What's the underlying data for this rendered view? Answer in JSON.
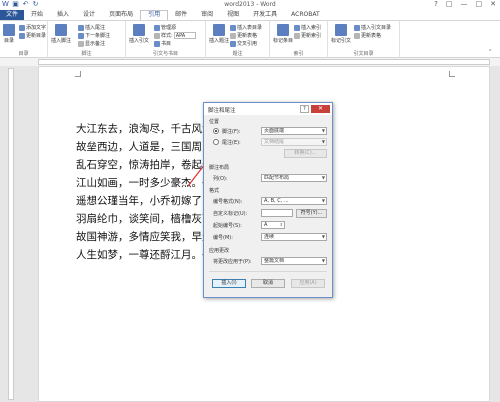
{
  "window": {
    "title": "word2013 - Word",
    "controls": [
      "?",
      "□",
      "—",
      "□",
      "✕"
    ]
  },
  "tabs": [
    "文件",
    "开始",
    "插入",
    "设计",
    "页面布局",
    "引用",
    "邮件",
    "审阅",
    "视图",
    "开发工具",
    "ACROBAT"
  ],
  "ribbon": {
    "toc": {
      "big": "目录",
      "items": [
        "添加文字",
        "更新目录"
      ],
      "label": "目录"
    },
    "footnotes": {
      "big": "插入脚注",
      "items": [
        "插入尾注",
        "下一条脚注",
        "显示备注"
      ],
      "label": "脚注"
    },
    "citations": {
      "big": "插入引文",
      "items": [
        "管理源",
        "样式:",
        "书目"
      ],
      "style_value": "APA",
      "label": "引文与书目"
    },
    "captions": {
      "big": "插入题注",
      "items": [
        "插入表目录",
        "更新表格",
        "交叉引用"
      ],
      "label": "题注"
    },
    "index": {
      "big": "标记条目",
      "items": [
        "插入索引",
        "更新索引"
      ],
      "label": "索引"
    },
    "authorities": {
      "big": "标记引文",
      "items": [
        "插入引文目录",
        "更新表格"
      ],
      "label": "引文目录"
    }
  },
  "document": {
    "lines": [
      "大江东去，浪淘尽，千古风流人物",
      "故垒西边，人道是，三国周郎赤壁",
      "乱石穿空，惊涛拍岸，卷起千堆雪",
      "江山如画，一时多少豪杰。↵",
      "遥想公瑾当年，小乔初嫁了，雄姿",
      "羽扇纶巾，谈笑间，樯橹灰飞烟灭",
      "故国神游，多情应笑我，早生华发",
      "人生如梦，一尊还酹江月。↵"
    ]
  },
  "dialog": {
    "title": "脚注和尾注",
    "help": "?",
    "close": "✕",
    "location_label": "位置",
    "footnote_label": "脚注(F):",
    "footnote_value": "页面底端",
    "endnote_label": "尾注(E):",
    "endnote_value": "文档结尾",
    "convert_button": "转换(C)...",
    "layout_label": "脚注布局",
    "columns_label": "列(O):",
    "columns_value": "匹配节布局",
    "format_label": "格式",
    "number_format_label": "编号格式(N):",
    "number_format_value": "A, B, C, ...",
    "custom_mark_label": "自定义标记(U):",
    "symbol_button": "符号(Y)...",
    "start_at_label": "起始编号(S):",
    "start_at_value": "A",
    "numbering_label": "编号(M):",
    "numbering_value": "连续",
    "apply_label": "应用更改",
    "apply_to_label": "将更改应用于(P):",
    "apply_to_value": "整篇文档",
    "insert_button": "插入(I)",
    "cancel_button": "取消",
    "apply_button": "应用(A)"
  }
}
